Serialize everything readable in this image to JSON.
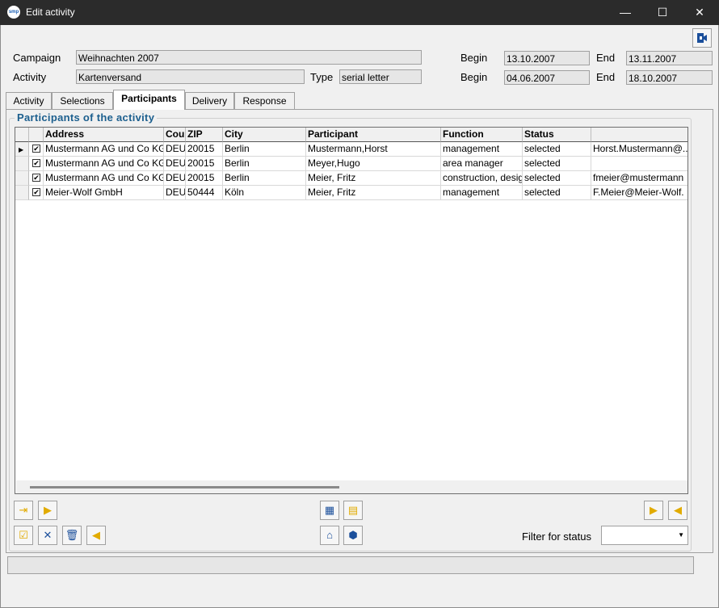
{
  "window": {
    "title": "Edit activity",
    "app_icon_text": "smp",
    "minimize_glyph": "—",
    "maximize_glyph": "☐",
    "close_glyph": "✕"
  },
  "form": {
    "campaign_label": "Campaign",
    "campaign_value": "Weihnachten 2007",
    "activity_label": "Activity",
    "activity_value": "Kartenversand",
    "type_label": "Type",
    "type_value": "serial letter",
    "begin_label_1": "Begin",
    "begin_value_1": "13.10.2007",
    "end_label_1": "End",
    "end_value_1": "13.11.2007",
    "begin_label_2": "Begin",
    "begin_value_2": "04.06.2007",
    "end_label_2": "End",
    "end_value_2": "18.10.2007"
  },
  "tabs": [
    {
      "label": "Activity"
    },
    {
      "label": "Selections"
    },
    {
      "label": "Participants",
      "active": true
    },
    {
      "label": "Delivery"
    },
    {
      "label": "Response"
    }
  ],
  "group": {
    "title": "Participants of the activity"
  },
  "grid": {
    "columns": [
      "Address",
      "Cou",
      "ZIP",
      "City",
      "Participant",
      "Function",
      "Status",
      ""
    ],
    "rows": [
      {
        "checked": true,
        "current": true,
        "cells": [
          "Mustermann AG und Co KG",
          "DEU",
          "20015",
          "Berlin",
          "Mustermann,Horst",
          "management",
          "selected",
          "Horst.Mustermann@..."
        ]
      },
      {
        "checked": true,
        "current": false,
        "cells": [
          "Mustermann AG und Co KG",
          "DEU",
          "20015",
          "Berlin",
          "Meyer,Hugo",
          "area manager",
          "selected",
          ""
        ]
      },
      {
        "checked": true,
        "current": false,
        "cells": [
          "Mustermann AG und Co KG",
          "DEU",
          "20015",
          "Berlin",
          "Meier, Fritz",
          "construction, design",
          "selected",
          "fmeier@mustermann"
        ]
      },
      {
        "checked": true,
        "current": false,
        "cells": [
          "Meier-Wolf GmbH",
          "DEU",
          "50444",
          "Köln",
          "Meier, Fritz",
          "management",
          "selected",
          "F.Meier@Meier-Wolf."
        ]
      }
    ]
  },
  "toolbar_icons": [
    "import-in-icon",
    "import-icon",
    "grid-view-icon",
    "document-icon",
    "export-icon",
    "import-right-icon",
    "select-all-icon",
    "delete-x-icon",
    "trash-icon",
    "back-icon",
    "home-icon",
    "group-icon"
  ],
  "filter": {
    "label": "Filter for status",
    "value": ""
  },
  "colors": {
    "titlebar": "#2b2b2b",
    "group_title": "#1c5f8e",
    "icon_yellow": "#e1ab00",
    "icon_blue": "#1b4f9b"
  }
}
